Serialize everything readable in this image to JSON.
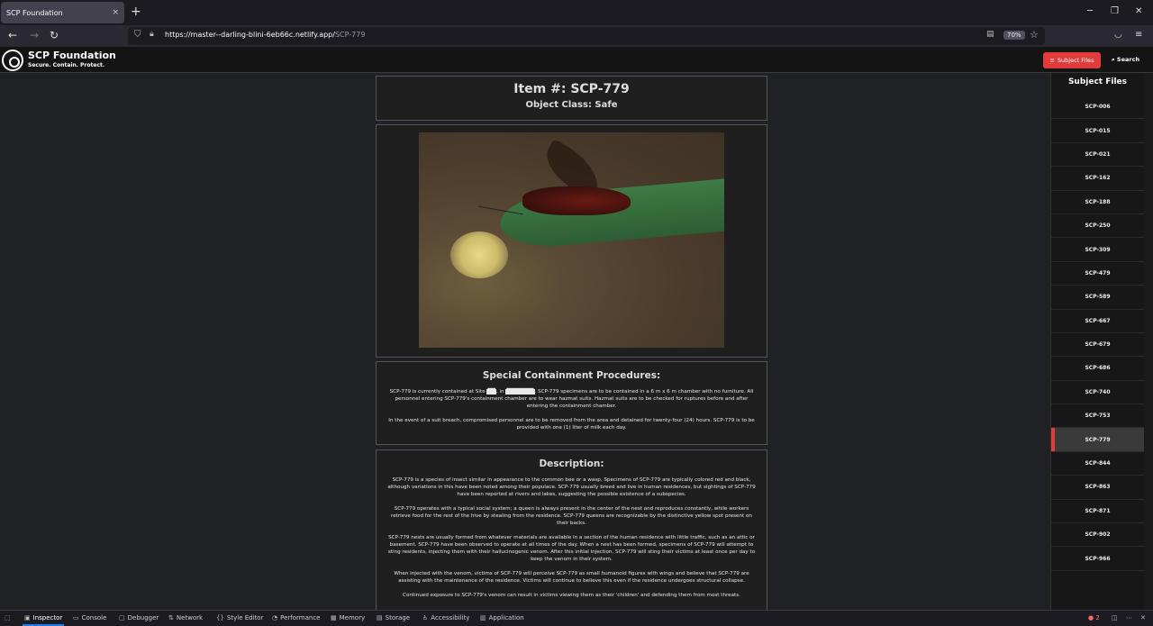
{
  "browser": {
    "tab_title": "SCP Foundation",
    "tab_close": "×",
    "new_tab": "+",
    "url_host": "https://master--darling-blini-6eb66c.netlify.app/",
    "url_path": "SCP-779",
    "zoom": "70%"
  },
  "header": {
    "logo_title": "SCP Foundation",
    "logo_subtitle": "Secure. Contain. Protect.",
    "subject_files_button": "Subject Files",
    "search_button": "Search"
  },
  "item": {
    "title": "Item #: SCP-779",
    "object_class": "Object Class: Safe"
  },
  "containment": {
    "heading": "Special Containment Procedures:",
    "p1_a": "SCP-779 is currently contained at Site ",
    "p1_r1": "██",
    "p1_b": ", in ",
    "p1_r2": "███████",
    "p1_c": ". SCP-779 specimens are to be contained in a 6 m x 6 m chamber with no furniture. All personnel entering SCP-779's containment chamber are to wear hazmat suits. Hazmat suits are to be checked for ruptures before and after entering the containment chamber.",
    "p2": "In the event of a suit breach, compromised personnel are to be removed from the area and detained for twenty-four (24) hours. SCP-779 is to be provided with one (1) liter of milk each day."
  },
  "description": {
    "heading": "Description:",
    "p1": "SCP-779 is a species of insect similar in appearance to the common bee or a wasp. Specimens of SCP-779 are typically colored red and black, although variations in this have been noted among their populace. SCP-779 usually breed and live in human residences, but sightings of SCP-779 have been reported at rivers and lakes, suggesting the possible existence of a subspecies.",
    "p2": "SCP-779 operates with a typical social system; a queen is always present in the center of the nest and reproduces constantly, while workers retrieve food for the rest of the hive by stealing from the residence. SCP-779 queens are recognizable by the distinctive yellow spot present on their backs.",
    "p3": "SCP-779 nests are usually formed from whatever materials are available in a section of the human residence with little traffic, such as an attic or basement. SCP-779 have been observed to operate at all times of the day. When a nest has been formed, specimens of SCP-779 will attempt to sting residents, injecting them with their hallucinogenic venom. After this initial injection, SCP-779 will sting their victims at least once per day to keep the venom in their system.",
    "p4": "When injected with the venom, victims of SCP-779 will perceive SCP-779 as small humanoid figures with wings and believe that SCP-779 are assisting with the maintenance of the residence. Victims will continue to believe this even if the residence undergoes structural collapse.",
    "p5": "Continued exposure to SCP-779's venom can result in victims viewing them as their 'children' and defending them from most threats."
  },
  "sidebar": {
    "title": "Subject Files",
    "items": [
      "SCP-006",
      "SCP-015",
      "SCP-021",
      "SCP-162",
      "SCP-188",
      "SCP-250",
      "SCP-309",
      "SCP-479",
      "SCP-589",
      "SCP-667",
      "SCP-679",
      "SCP-686",
      "SCP-740",
      "SCP-753",
      "SCP-779",
      "SCP-844",
      "SCP-863",
      "SCP-871",
      "SCP-902",
      "SCP-966"
    ],
    "active": "SCP-779"
  },
  "devtools": {
    "tabs": [
      "Inspector",
      "Console",
      "Debugger",
      "Network",
      "Style Editor",
      "Performance",
      "Memory",
      "Storage",
      "Accessibility",
      "Application"
    ],
    "error_count": "2"
  },
  "colors": {
    "accent": "#e23b3b",
    "background": "#202124",
    "panel": "#1f1f1f"
  }
}
